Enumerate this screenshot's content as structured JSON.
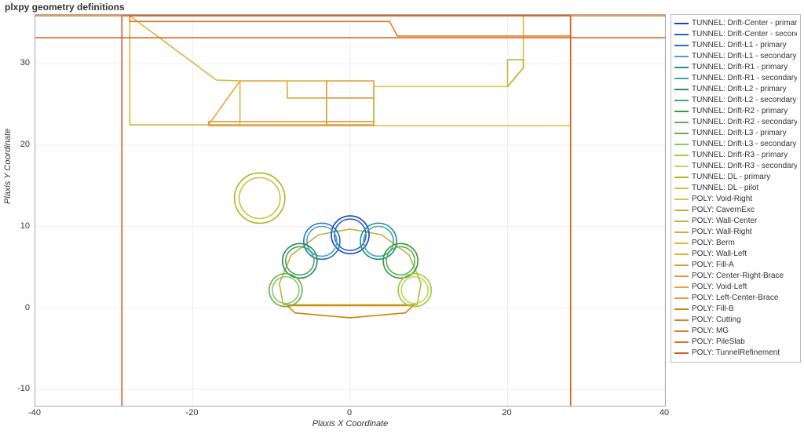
{
  "chart_data": {
    "type": "line",
    "title": "plxpy geometry definitions",
    "xlabel": "Plaxis X Coordinate",
    "ylabel": "Plaxis Y Coordinate",
    "xlim": [
      -40,
      40
    ],
    "ylim": [
      -12,
      36
    ],
    "xticks": [
      -40,
      -20,
      0,
      20,
      40
    ],
    "yticks": [
      -10,
      0,
      10,
      20,
      30
    ],
    "tunnels": [
      {
        "name": "Drift-Center",
        "parts": [
          "primary",
          "secondary"
        ],
        "cx": 0,
        "cy": 9,
        "rp": 2.4,
        "rs": 2.0,
        "color_p": "#1f3fbf",
        "color_s": "#2660d9"
      },
      {
        "name": "Drift-L1",
        "parts": [
          "primary",
          "secondary"
        ],
        "cx": -3.6,
        "cy": 8.2,
        "rp": 2.3,
        "rs": 1.9,
        "color_p": "#1f77b4",
        "color_s": "#4a9ed9"
      },
      {
        "name": "Drift-R1",
        "parts": [
          "primary",
          "secondary"
        ],
        "cx": 3.6,
        "cy": 8.2,
        "rp": 2.3,
        "rs": 1.9,
        "color_p": "#1f8f8f",
        "color_s": "#3aa8a8"
      },
      {
        "name": "Drift-L2",
        "parts": [
          "primary",
          "secondary"
        ],
        "cx": -6.4,
        "cy": 5.8,
        "rp": 2.2,
        "rs": 1.8,
        "color_p": "#2e8b57",
        "color_s": "#45a36d"
      },
      {
        "name": "Drift-R2",
        "parts": [
          "primary",
          "secondary"
        ],
        "cx": 6.4,
        "cy": 5.8,
        "rp": 2.2,
        "rs": 1.8,
        "color_p": "#3a9a3a",
        "color_s": "#55b255"
      },
      {
        "name": "Drift-L3",
        "parts": [
          "primary",
          "secondary"
        ],
        "cx": -8.2,
        "cy": 2.2,
        "rp": 2.1,
        "rs": 1.7,
        "color_p": "#6ab04c",
        "color_s": "#88c76d"
      },
      {
        "name": "Drift-R3",
        "parts": [
          "primary",
          "secondary"
        ],
        "cx": 8.2,
        "cy": 2.2,
        "rp": 2.1,
        "rs": 1.7,
        "color_p": "#9acd32",
        "color_s": "#b4db5e"
      },
      {
        "name": "DL",
        "parts": [
          "primary",
          "pilot"
        ],
        "cx": -11.5,
        "cy": 13.5,
        "rp": 3.2,
        "rs": 2.6,
        "color_p": "#a8b820",
        "color_s": "#c0c83e"
      }
    ],
    "polys": [
      {
        "name": "CavernExc",
        "color": "#c2b13a",
        "points": [
          [
            -8.5,
            0.4
          ],
          [
            -9.0,
            3.0
          ],
          [
            -7.5,
            6.5
          ],
          [
            -4.0,
            9.0
          ],
          [
            0,
            9.7
          ],
          [
            4.0,
            9.0
          ],
          [
            7.5,
            6.5
          ],
          [
            9.0,
            3.0
          ],
          [
            8.5,
            0.4
          ],
          [
            -8.5,
            0.4
          ]
        ]
      },
      {
        "name": "Fill-B",
        "color": "#cc8400",
        "points": [
          [
            -8,
            0.3
          ],
          [
            8,
            0.3
          ],
          [
            7,
            -0.6
          ],
          [
            0,
            -1.2
          ],
          [
            -7,
            -0.6
          ],
          [
            -8,
            0.3
          ]
        ]
      },
      {
        "name": "Void-Right",
        "color": "#d6c24a",
        "points": [
          [
            3,
            22.4
          ],
          [
            3,
            27.2
          ],
          [
            20,
            27.2
          ],
          [
            22,
            29.5
          ],
          [
            22,
            35.9
          ],
          [
            28,
            35.9
          ],
          [
            28,
            22.4
          ],
          [
            3,
            22.4
          ]
        ]
      },
      {
        "name": "Void-Left",
        "color": "#e8a23d",
        "points": [
          [
            -18,
            22.5
          ],
          [
            -14,
            27.9
          ],
          [
            -8,
            27.9
          ],
          [
            -8,
            25.8
          ],
          [
            -3,
            25.8
          ],
          [
            -3,
            22.5
          ],
          [
            -18,
            22.5
          ]
        ]
      },
      {
        "name": "Wall-Center",
        "color": "#c8b03a",
        "points": [
          [
            -3,
            22.5
          ],
          [
            -3,
            25.8
          ],
          [
            3,
            25.8
          ],
          [
            3,
            22.5
          ],
          [
            -3,
            22.5
          ]
        ]
      },
      {
        "name": "Wall-Right",
        "color": "#c8b03a",
        "points": [
          [
            20,
            27.2
          ],
          [
            20,
            30.5
          ],
          [
            22,
            30.5
          ],
          [
            22,
            29.5
          ],
          [
            20,
            27.2
          ]
        ]
      },
      {
        "name": "Wall-Left",
        "color": "#d9b33d",
        "points": [
          [
            -8,
            25.8
          ],
          [
            -8,
            27.9
          ],
          [
            -3,
            27.9
          ],
          [
            -3,
            25.8
          ],
          [
            -8,
            25.8
          ]
        ]
      },
      {
        "name": "Berm",
        "color": "#d4b83e",
        "points": [
          [
            -28,
            35.9
          ],
          [
            -17,
            28.0
          ],
          [
            -14,
            27.9
          ],
          [
            -14,
            22.5
          ],
          [
            -28,
            22.5
          ],
          [
            -28,
            35.9
          ]
        ]
      },
      {
        "name": "Fill-A",
        "color": "#dfa040",
        "points": [
          [
            -3,
            25.8
          ],
          [
            -3,
            27.9
          ],
          [
            3,
            27.9
          ],
          [
            3,
            27.2
          ],
          [
            3,
            25.8
          ],
          [
            -3,
            25.8
          ]
        ]
      },
      {
        "name": "Center-Right-Brace",
        "color": "#e8963b",
        "points": [
          [
            -3,
            22.4
          ],
          [
            3,
            22.4
          ],
          [
            3,
            22.9
          ],
          [
            -3,
            22.9
          ],
          [
            -3,
            22.4
          ]
        ]
      },
      {
        "name": "Left-Center-Brace",
        "color": "#e8963b",
        "points": [
          [
            -18,
            22.4
          ],
          [
            -3,
            22.4
          ],
          [
            -3,
            22.9
          ],
          [
            -18,
            22.9
          ],
          [
            -18,
            22.4
          ]
        ]
      },
      {
        "name": "Cutting",
        "color": "#e47a2a",
        "points": [
          [
            -28,
            35.9
          ],
          [
            28,
            35.9
          ],
          [
            28,
            33.4
          ],
          [
            6,
            33.4
          ],
          [
            5,
            35.2
          ],
          [
            -28,
            35.2
          ],
          [
            -28,
            35.9
          ]
        ]
      },
      {
        "name": "MG",
        "color": "#e47a2a",
        "points": [
          [
            -40,
            35.9
          ],
          [
            40,
            35.9
          ]
        ]
      },
      {
        "name": "PileSlab",
        "color": "#de6a25",
        "points": [
          [
            -40,
            33.2
          ],
          [
            40,
            33.2
          ]
        ]
      },
      {
        "name": "TunnelRefinement",
        "color": "#d85a1f",
        "points": [
          [
            -29,
            -12
          ],
          [
            -29,
            35.9
          ],
          [
            28,
            35.9
          ],
          [
            28,
            -12
          ]
        ]
      }
    ],
    "legend": [
      {
        "label": "TUNNEL: Drift-Center - primary",
        "color": "#1f3fbf"
      },
      {
        "label": "TUNNEL: Drift-Center - secondary",
        "color": "#2660d9"
      },
      {
        "label": "TUNNEL: Drift-L1 - primary",
        "color": "#1f77b4"
      },
      {
        "label": "TUNNEL: Drift-L1 - secondary",
        "color": "#4a9ed9"
      },
      {
        "label": "TUNNEL: Drift-R1 - primary",
        "color": "#1f8f8f"
      },
      {
        "label": "TUNNEL: Drift-R1 - secondary",
        "color": "#3aa8a8"
      },
      {
        "label": "TUNNEL: Drift-L2 - primary",
        "color": "#2e8b57"
      },
      {
        "label": "TUNNEL: Drift-L2 - secondary",
        "color": "#45a36d"
      },
      {
        "label": "TUNNEL: Drift-R2 - primary",
        "color": "#3a9a3a"
      },
      {
        "label": "TUNNEL: Drift-R2 - secondary",
        "color": "#55b255"
      },
      {
        "label": "TUNNEL: Drift-L3 - primary",
        "color": "#6ab04c"
      },
      {
        "label": "TUNNEL: Drift-L3 - secondary",
        "color": "#88c76d"
      },
      {
        "label": "TUNNEL: Drift-R3 - primary",
        "color": "#9acd32"
      },
      {
        "label": "TUNNEL: Drift-R3 - secondary",
        "color": "#b4db5e"
      },
      {
        "label": "TUNNEL: DL - primary",
        "color": "#a8b820"
      },
      {
        "label": "TUNNEL: DL - pilot",
        "color": "#c0c83e"
      },
      {
        "label": "POLY: Void-Right",
        "color": "#d6c24a"
      },
      {
        "label": "POLY: CavernExc",
        "color": "#c2b13a"
      },
      {
        "label": "POLY: Wall-Center",
        "color": "#c8b03a"
      },
      {
        "label": "POLY: Wall-Right",
        "color": "#c8b03a"
      },
      {
        "label": "POLY: Berm",
        "color": "#d4b83e"
      },
      {
        "label": "POLY: Wall-Left",
        "color": "#d9b33d"
      },
      {
        "label": "POLY: Fill-A",
        "color": "#dfa040"
      },
      {
        "label": "POLY: Center-Right-Brace",
        "color": "#e8963b"
      },
      {
        "label": "POLY: Void-Left",
        "color": "#e8a23d"
      },
      {
        "label": "POLY: Left-Center-Brace",
        "color": "#e8963b"
      },
      {
        "label": "POLY: Fill-B",
        "color": "#cc8400"
      },
      {
        "label": "POLY: Cutting",
        "color": "#e47a2a"
      },
      {
        "label": "POLY: MG",
        "color": "#e47a2a"
      },
      {
        "label": "POLY: PileSlab",
        "color": "#de6a25"
      },
      {
        "label": "POLY: TunnelRefinement",
        "color": "#d85a1f"
      }
    ]
  }
}
